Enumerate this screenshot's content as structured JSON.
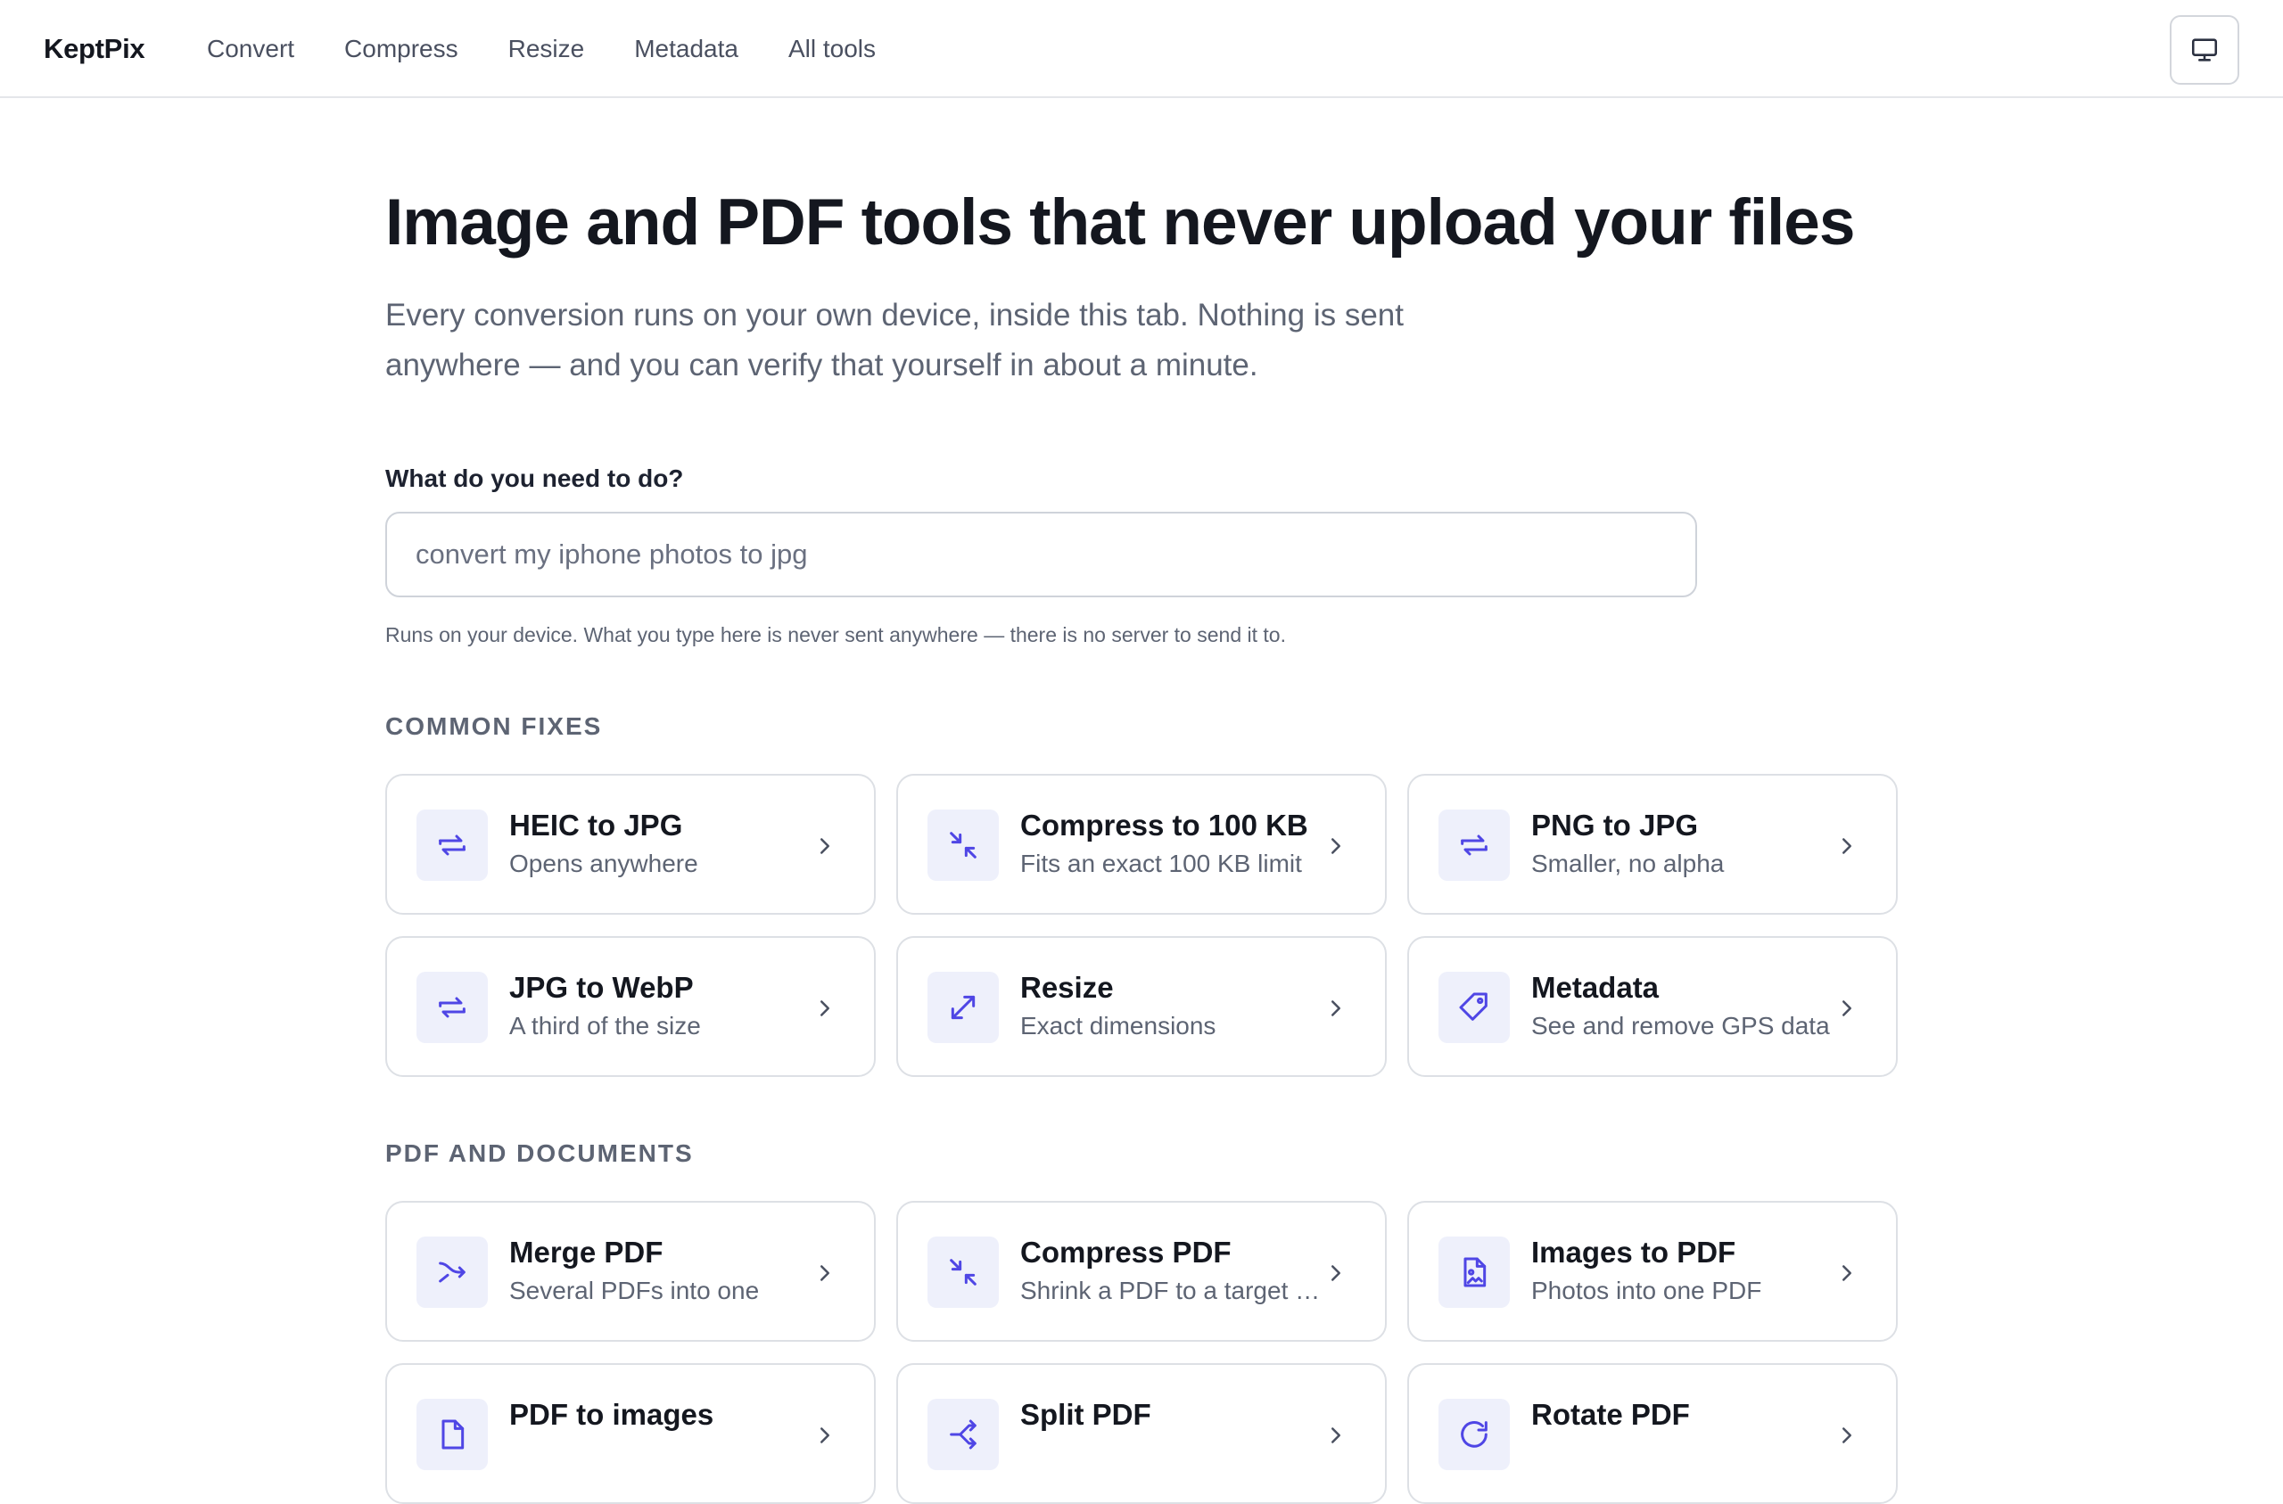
{
  "header": {
    "brand": "KeptPix",
    "nav": [
      "Convert",
      "Compress",
      "Resize",
      "Metadata",
      "All tools"
    ],
    "display_icon": "monitor-icon"
  },
  "hero": {
    "title": "Image and PDF tools that never upload your files",
    "subtitle": "Every conversion runs on your own device, inside this tab. Nothing is sent anywhere — and you can verify that yourself in about a minute."
  },
  "search": {
    "label": "What do you need to do?",
    "placeholder": "convert my iphone photos to jpg",
    "note": "Runs on your device. What you type here is never sent anywhere — there is no server to send it to."
  },
  "sections": {
    "common": {
      "heading": "COMMON FIXES",
      "cards": [
        {
          "title": "HEIC to JPG",
          "desc": "Opens anywhere",
          "icon": "convert-arrows-icon"
        },
        {
          "title": "Compress to 100 KB",
          "desc": "Fits an exact 100 KB limit",
          "icon": "compress-arrows-icon"
        },
        {
          "title": "PNG to JPG",
          "desc": "Smaller, no alpha",
          "icon": "convert-arrows-icon"
        },
        {
          "title": "JPG to WebP",
          "desc": "A third of the size",
          "icon": "convert-arrows-icon"
        },
        {
          "title": "Resize",
          "desc": "Exact dimensions",
          "icon": "resize-arrows-icon"
        },
        {
          "title": "Metadata",
          "desc": "See and remove GPS data",
          "icon": "tag-icon"
        }
      ]
    },
    "pdf": {
      "heading": "PDF AND DOCUMENTS",
      "cards": [
        {
          "title": "Merge PDF",
          "desc": "Several PDFs into one",
          "icon": "merge-icon"
        },
        {
          "title": "Compress PDF",
          "desc": "Shrink a PDF to a target size",
          "icon": "compress-arrows-icon"
        },
        {
          "title": "Images to PDF",
          "desc": "Photos into one PDF",
          "icon": "image-file-icon"
        },
        {
          "title": "PDF to images",
          "desc": "",
          "icon": "file-icon"
        },
        {
          "title": "Split PDF",
          "desc": "",
          "icon": "split-icon"
        },
        {
          "title": "Rotate PDF",
          "desc": "",
          "icon": "rotate-icon"
        }
      ]
    }
  },
  "colors": {
    "accent": "#4f46e5",
    "icon_bg": "#eef0fb",
    "text": "#14171f",
    "muted": "#5d6473",
    "border": "#dde0e5"
  }
}
